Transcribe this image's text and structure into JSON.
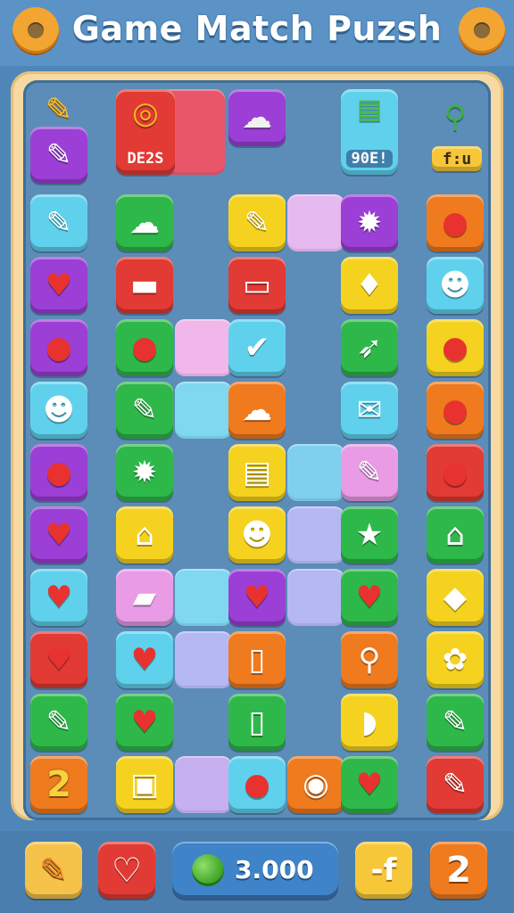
{
  "header": {
    "title": "Game Match Puzsh",
    "left_icon": "gear-icon",
    "right_icon": "gear-icon"
  },
  "top_panel": {
    "badge_left_text": "DE2S",
    "badge_right_text": "90E!",
    "tag_text": "f:u"
  },
  "footer": {
    "score_value": "3.000",
    "power_label": "-f",
    "level_label": "2",
    "left_icon": "pencil-icon",
    "heart_icon": "heart-icon",
    "coin_icon": "coin-icon"
  },
  "tiles": [
    {
      "icon": "pencil-icon",
      "glyph": "✎",
      "color": "#9b3fd6"
    },
    {
      "icon": "pencil-icon",
      "glyph": "✎",
      "color": "#5fd1ec"
    },
    {
      "icon": "cloud-icon",
      "glyph": "☁",
      "color": "#2fb84a"
    },
    {
      "icon": "brush-icon",
      "glyph": "✎",
      "color": "#f5d21f"
    },
    {
      "icon": "gear-icon",
      "glyph": "✹",
      "color": "#9b3fd6"
    },
    {
      "icon": "balloon-icon",
      "glyph": "●",
      "color": "#f07a1e"
    },
    {
      "icon": "heart-icon",
      "glyph": "♥",
      "color": "#9b3fd6"
    },
    {
      "icon": "eraser-icon",
      "glyph": "▬",
      "color": "#e23a34"
    },
    {
      "icon": "chat-icon",
      "glyph": "▭",
      "color": "#e23a34"
    },
    {
      "icon": "pin-icon",
      "glyph": "♦",
      "color": "#f5d21f"
    },
    {
      "icon": "smiley-icon",
      "glyph": "☻",
      "color": "#5fd1ec"
    },
    {
      "icon": "balloon-icon",
      "glyph": "●",
      "color": "#9b3fd6"
    },
    {
      "icon": "balloon-icon",
      "glyph": "●",
      "color": "#2fb84a"
    },
    {
      "icon": "leaf-icon",
      "glyph": "✔",
      "color": "#5fd1ec"
    },
    {
      "icon": "rocket-icon",
      "glyph": "➶",
      "color": "#2fb84a"
    },
    {
      "icon": "balloon-icon",
      "glyph": "●",
      "color": "#f5d21f"
    },
    {
      "icon": "smiley-icon",
      "glyph": "☻",
      "color": "#5fd1ec"
    },
    {
      "icon": "pencil-icon",
      "glyph": "✎",
      "color": "#2fb84a"
    },
    {
      "icon": "cloud-icon",
      "glyph": "☁",
      "color": "#f07a1e"
    },
    {
      "icon": "envelope-icon",
      "glyph": "✉",
      "color": "#5fd1ec"
    },
    {
      "icon": "balloon-icon",
      "glyph": "●",
      "color": "#f07a1e"
    },
    {
      "icon": "balloon-icon",
      "glyph": "●",
      "color": "#9b3fd6"
    },
    {
      "icon": "gear-icon",
      "glyph": "✹",
      "color": "#2fb84a"
    },
    {
      "icon": "bus-icon",
      "glyph": "▤",
      "color": "#f5d21f"
    },
    {
      "icon": "pencil-icon",
      "glyph": "✎",
      "color": "#e99be6"
    },
    {
      "icon": "balloon-icon",
      "glyph": "●",
      "color": "#e23a34"
    },
    {
      "icon": "heart-icon",
      "glyph": "♥",
      "color": "#9b3fd6"
    },
    {
      "icon": "house-icon",
      "glyph": "⌂",
      "color": "#f5d21f"
    },
    {
      "icon": "smiley-icon",
      "glyph": "☻",
      "color": "#f5d21f"
    },
    {
      "icon": "star-icon",
      "glyph": "★",
      "color": "#2fb84a"
    },
    {
      "icon": "house-icon",
      "glyph": "⌂",
      "color": "#2fb84a"
    },
    {
      "icon": "heart-icon",
      "glyph": "♥",
      "color": "#5fd1ec"
    },
    {
      "icon": "car-icon",
      "glyph": "▰",
      "color": "#e99be6"
    },
    {
      "icon": "heart-icon",
      "glyph": "♥",
      "color": "#9b3fd6"
    },
    {
      "icon": "heart-icon",
      "glyph": "♥",
      "color": "#2fb84a"
    },
    {
      "icon": "bottle-icon",
      "glyph": "◆",
      "color": "#f5d21f"
    },
    {
      "icon": "heart-icon",
      "glyph": "♥",
      "color": "#e23a34"
    },
    {
      "icon": "heart-icon",
      "glyph": "♥",
      "color": "#5fd1ec"
    },
    {
      "icon": "phone-icon",
      "glyph": "▯",
      "color": "#f07a1e"
    },
    {
      "icon": "pin-icon",
      "glyph": "⚲",
      "color": "#f07a1e"
    },
    {
      "icon": "flower-icon",
      "glyph": "✿",
      "color": "#f5d21f"
    },
    {
      "icon": "pencil-icon",
      "glyph": "✎",
      "color": "#2fb84a"
    },
    {
      "icon": "heart-icon",
      "glyph": "♥",
      "color": "#2fb84a"
    },
    {
      "icon": "phone-icon",
      "glyph": "▯",
      "color": "#2fb84a"
    },
    {
      "icon": "candy-icon",
      "glyph": "◗",
      "color": "#f5d21f"
    },
    {
      "icon": "brush-icon",
      "glyph": "✎",
      "color": "#2fb84a"
    },
    {
      "icon": "number-two",
      "glyph": "2",
      "color": "#f07a1e"
    },
    {
      "icon": "bag-icon",
      "glyph": "▣",
      "color": "#f5d21f"
    },
    {
      "icon": "balloon-icon",
      "glyph": "●",
      "color": "#5fd1ec"
    },
    {
      "icon": "target-icon",
      "glyph": "◉",
      "color": "#f07a1e"
    },
    {
      "icon": "heart-icon",
      "glyph": "♥",
      "color": "#2fb84a"
    },
    {
      "icon": "paint-icon",
      "glyph": "✎",
      "color": "#e23a34"
    }
  ]
}
